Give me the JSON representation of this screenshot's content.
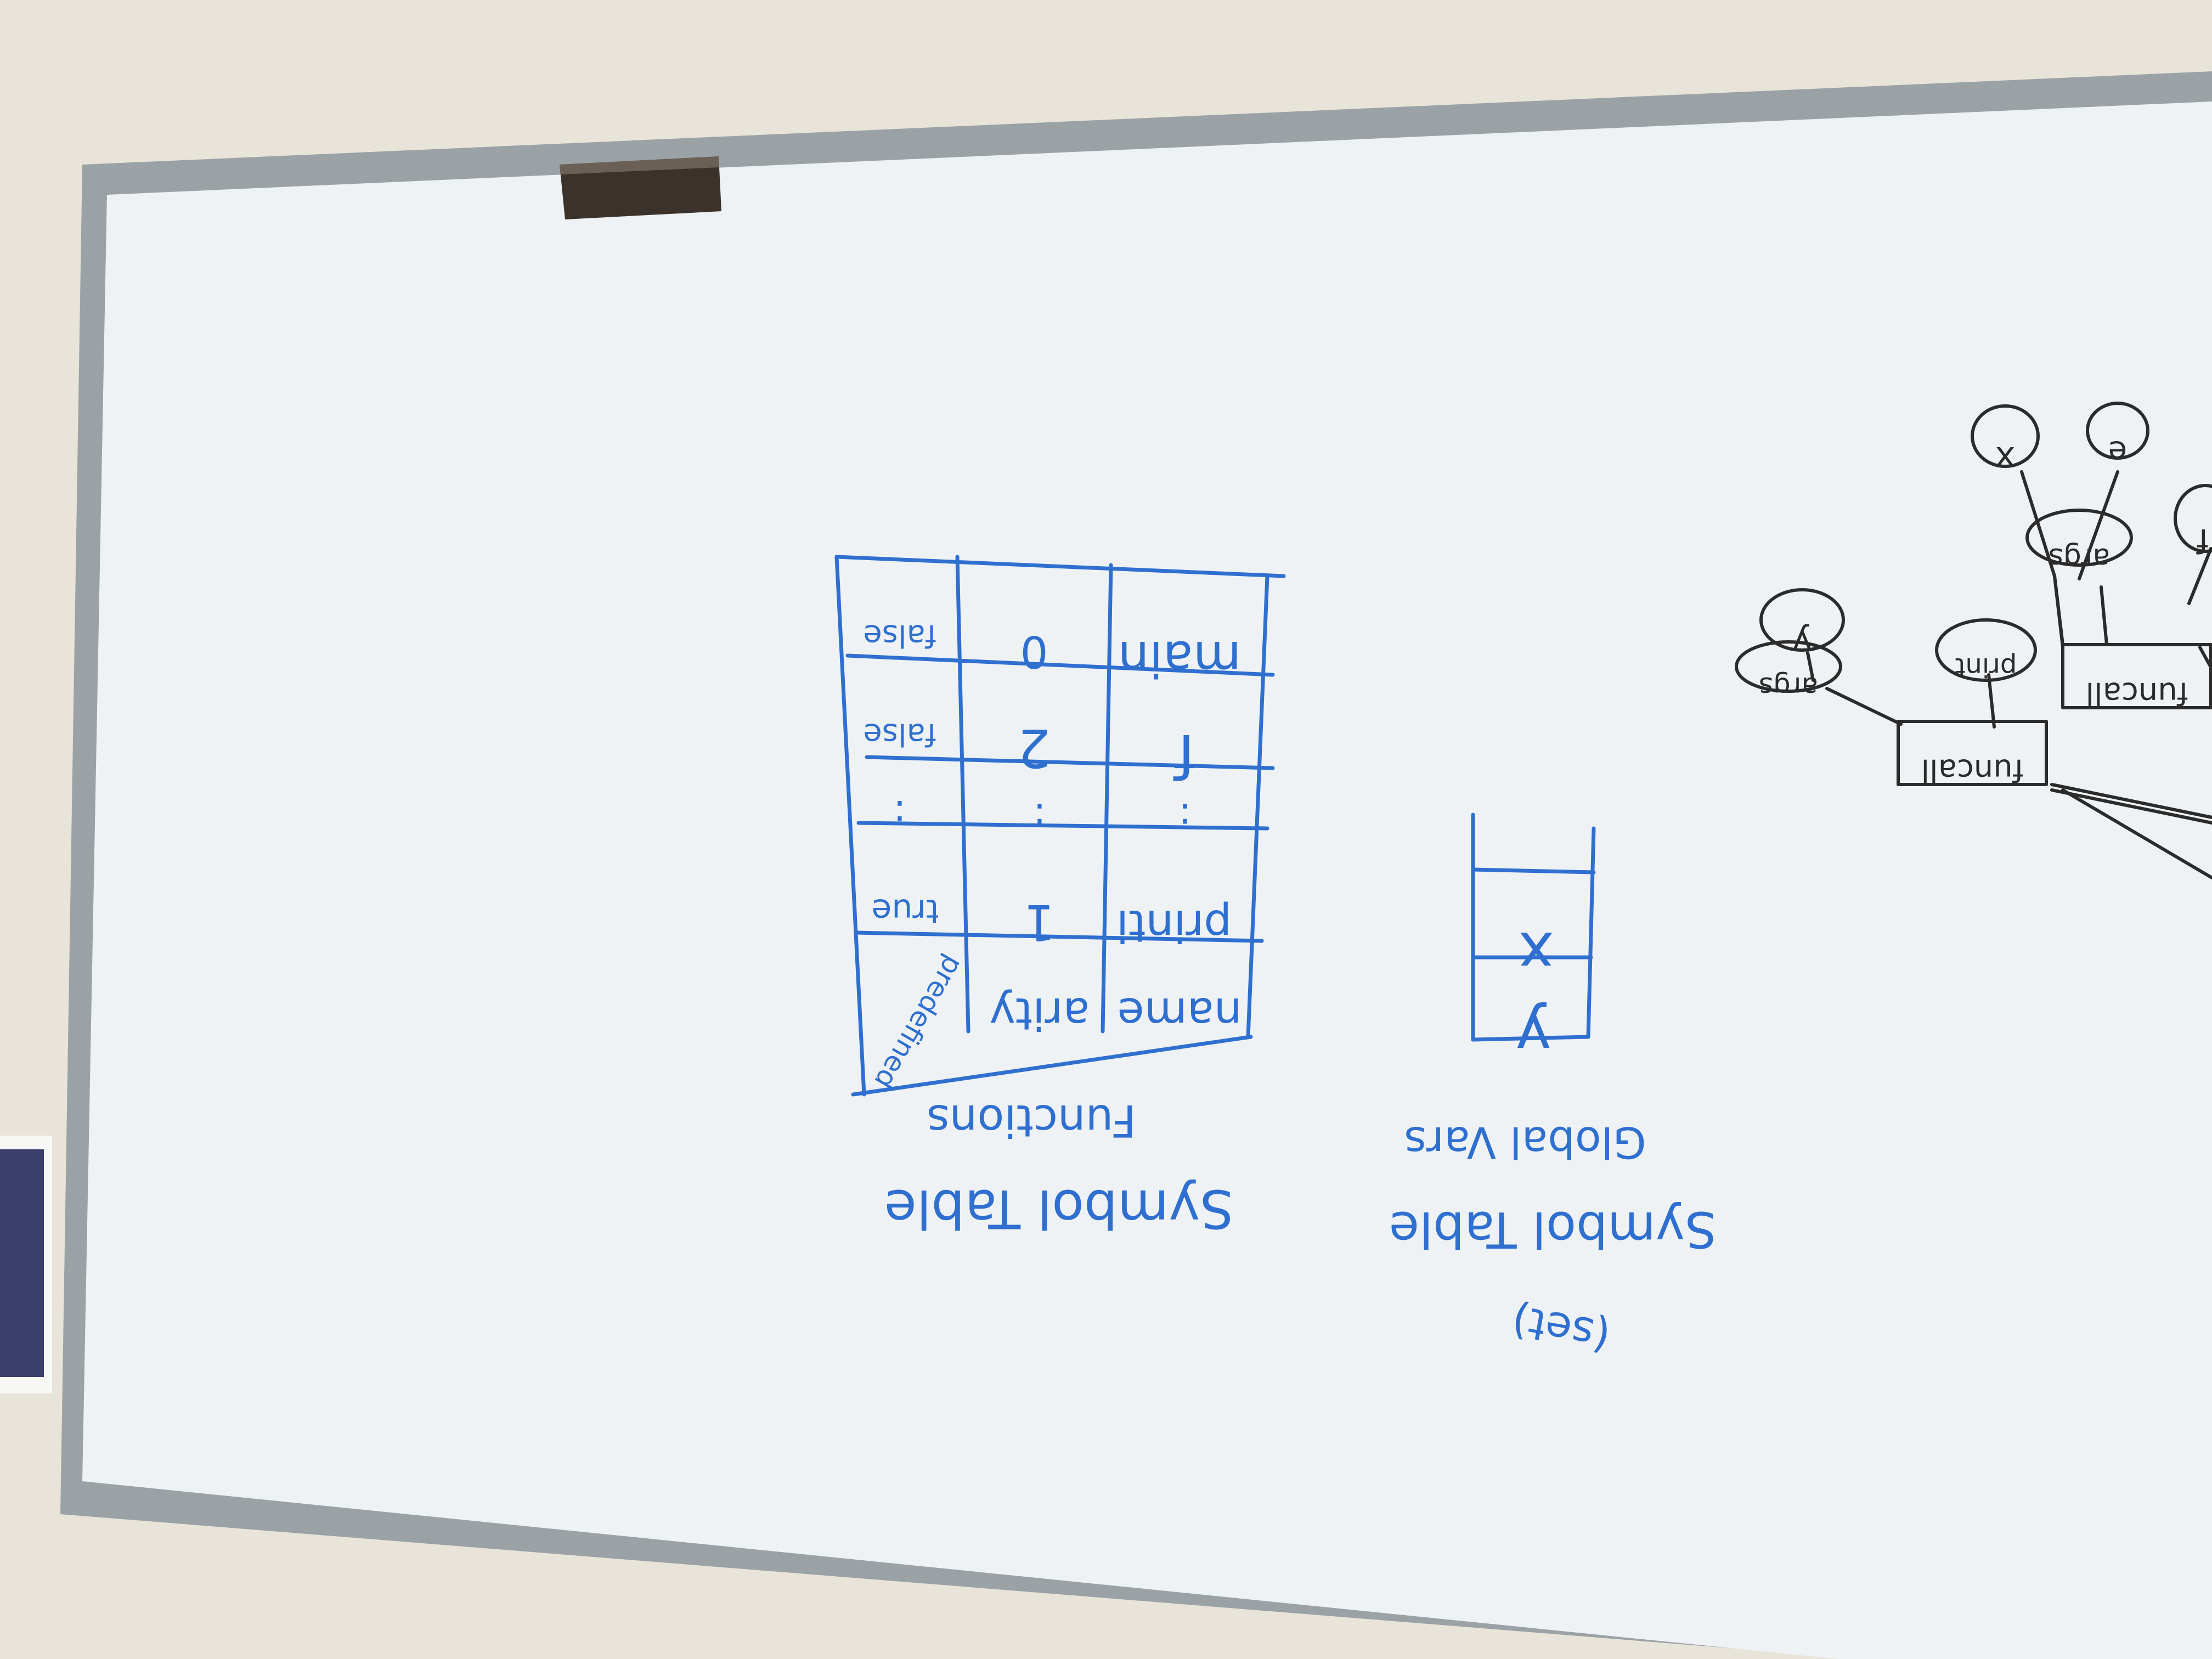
{
  "functions_table": {
    "caption": [
      "Symbol Table",
      "Functions"
    ],
    "side_note": "predefined",
    "columns": [
      "name",
      "arity",
      "predefined"
    ],
    "rows": [
      [
        "printi",
        "1",
        "true"
      ],
      [
        ":",
        ":",
        ":"
      ],
      [
        "f",
        "2",
        "false"
      ],
      [
        "main",
        "0",
        "false"
      ]
    ]
  },
  "globals_table": {
    "caption": [
      "Symbol Table",
      "Global Vars",
      "(set)"
    ],
    "cells": [
      "y",
      "x"
    ]
  },
  "tree": {
    "funcall_1": "funcall",
    "funcall_2": "funcall",
    "print_node": "print",
    "args_1": "args",
    "args_2": "args",
    "leaf_y": "y",
    "leaf_x": "x",
    "leaf_e": "e",
    "leaf_f": "f"
  },
  "colors": {
    "marker_blue": "#2f6fd0",
    "marker_black": "#2b2b2b",
    "wall": "#e9e4d9",
    "board": "#eef2f4",
    "frame": "#a9b0b3"
  }
}
